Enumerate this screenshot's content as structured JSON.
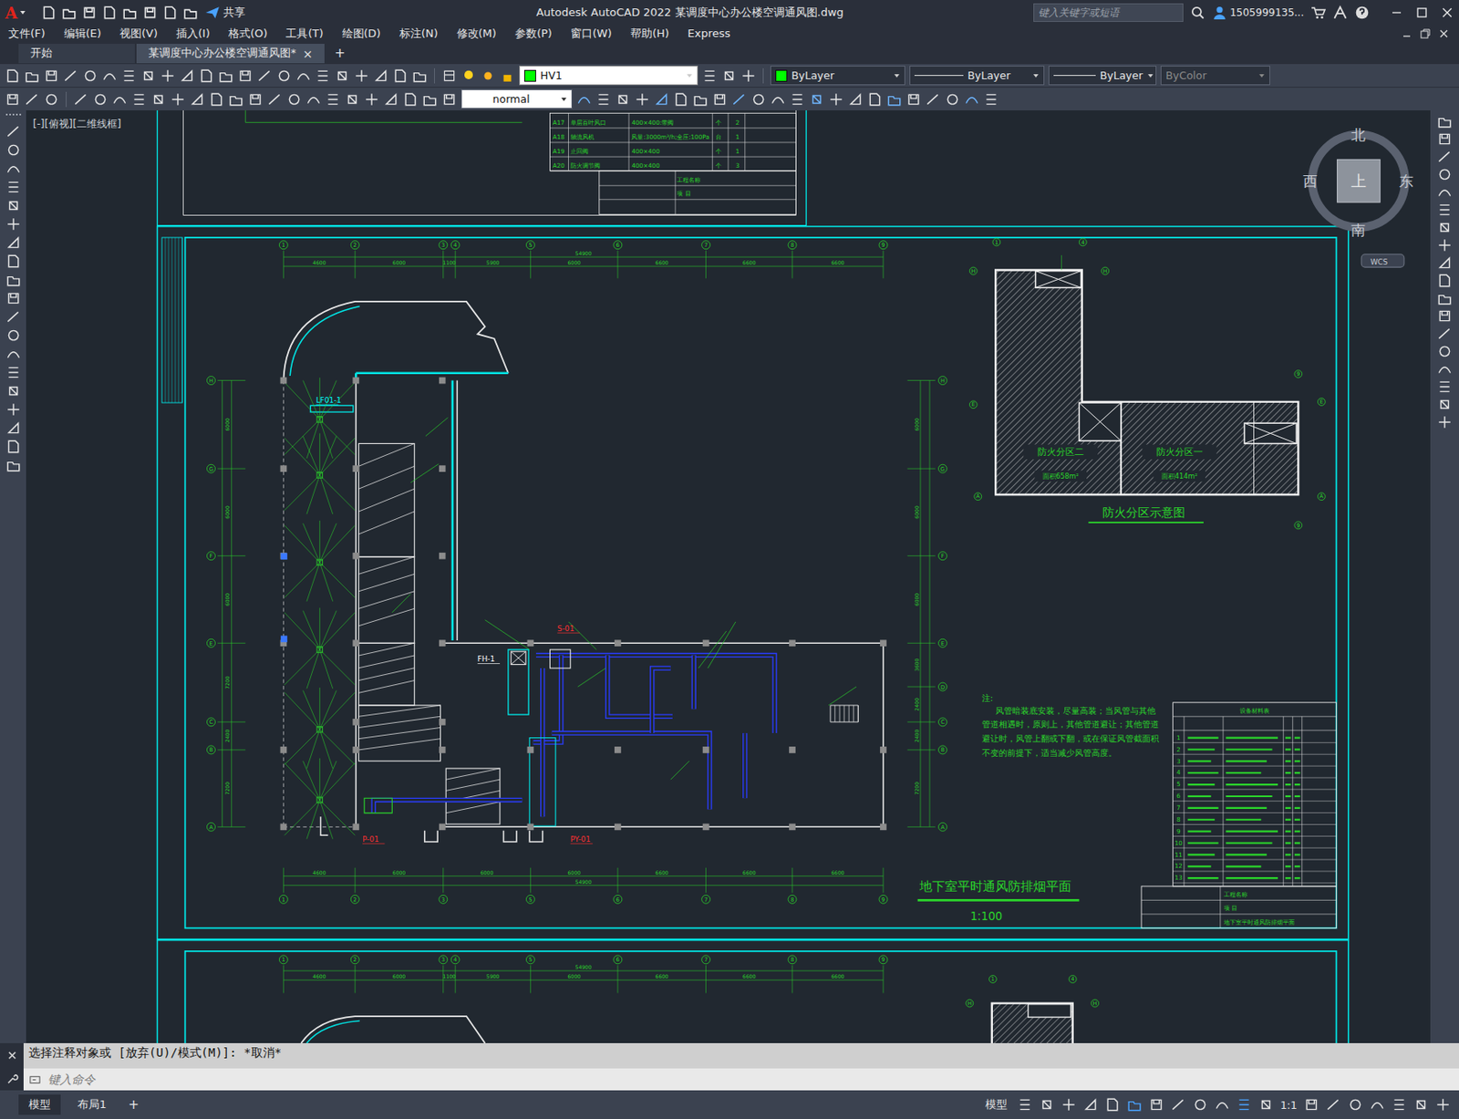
{
  "window": {
    "logo": "A",
    "share": "共享",
    "title": "Autodesk AutoCAD 2022    某调度中心办公楼空调通风图.dwg",
    "search": {
      "placeholder": "键入关键字或短语"
    },
    "user": "1505999135..."
  },
  "menu": [
    "文件(F)",
    "编辑(E)",
    "视图(V)",
    "插入(I)",
    "格式(O)",
    "工具(T)",
    "绘图(D)",
    "标注(N)",
    "修改(M)",
    "参数(P)",
    "窗口(W)",
    "帮助(H)",
    "Express"
  ],
  "tabs": [
    {
      "label": "开始",
      "selected": false
    },
    {
      "label": "某调度中心办公楼空调通风图*",
      "selected": true
    }
  ],
  "tab_close": "×",
  "tab_add": "+",
  "properties": {
    "layer": "HV1",
    "color": "ByLayer",
    "linetype": "ByLayer",
    "lineweight": "ByLayer",
    "plotstyle": {
      "value": "ByColor",
      "disabled": true
    },
    "textstyle": "normal"
  },
  "viewport_label": "[-][俯视][二维线框]",
  "viewcube": {
    "north": "北",
    "south": "南",
    "east": "东",
    "west": "西",
    "top": "上",
    "wcs": "WCS"
  },
  "drawing": {
    "top_axes": [
      "1",
      "2",
      "3",
      "4",
      "5",
      "6",
      "7",
      "8",
      "9"
    ],
    "bottom_axes": [
      "1",
      "2",
      "3",
      "5",
      "6",
      "7",
      "8",
      "9"
    ],
    "left_axes": [
      "H",
      "G",
      "F",
      "E",
      "C",
      "B",
      "A"
    ],
    "right_axes": [
      "H",
      "G",
      "F",
      "E",
      "D",
      "C",
      "B",
      "A"
    ],
    "top_total": "54900",
    "top_dims": [
      "4600",
      "6000",
      "1100",
      "5900",
      "6000",
      "6600",
      "6600",
      "6600"
    ],
    "bottom_total": "54900",
    "bottom_dims": [
      "4600",
      "6000",
      "6000",
      "6000",
      "6600",
      "6600",
      "6600"
    ],
    "left_dims": [
      "6000",
      "6000",
      "6000",
      "7200",
      "2400",
      "7200"
    ],
    "right_dims": [
      "6000",
      "6000",
      "6000",
      "3600",
      "2400",
      "2400",
      "7200"
    ],
    "labels": [
      {
        "text": "S-01",
        "color": "#ff3030"
      },
      {
        "text": "P-01",
        "color": "#ff3030"
      },
      {
        "text": "PY-01",
        "color": "#ff3030"
      },
      {
        "text": "LF01-1",
        "color": "#00ffff"
      },
      {
        "text": "FH-1",
        "color": "#ffffff"
      }
    ],
    "plan_title": "地下室平时通风防排烟平面",
    "plan_scale": "1:100",
    "fire_zone": {
      "title": "防火分区示意图",
      "zones": [
        {
          "name": "防火分区二",
          "area": "面积658m²"
        },
        {
          "name": "防火分区一",
          "area": "面积414m²"
        }
      ],
      "axes": [
        "1",
        "4",
        "H",
        "H",
        "E",
        "E",
        "A",
        "A",
        "9",
        "9"
      ]
    },
    "note": {
      "title": "注:",
      "lines": [
        "风管暗装底安装，尽量高装；当风管与其他",
        "管道相遇时，原则上，其他管道避让；其他管道",
        "避让时，风管上翻或下翻，或在保证风管截面积",
        "不变的前提下，适当减少风管高度。"
      ]
    },
    "upper_table": [
      {
        "no": "A17",
        "name": "单层百叶风口",
        "spec": "400×400:带阀",
        "unit": "个",
        "qty": "2"
      },
      {
        "no": "A18",
        "name": "轴流风机",
        "spec": "风量:3000m³/h;全压:100Pa",
        "unit": "台",
        "qty": "1"
      },
      {
        "no": "A19",
        "name": "止回阀",
        "spec": "400×400",
        "unit": "个",
        "qty": "1"
      },
      {
        "no": "A20",
        "name": "防火调节阀",
        "spec": "400×400",
        "unit": "个",
        "qty": "3"
      }
    ],
    "equipment_table": {
      "title": "设备材料表",
      "rows": [
        "1",
        "2",
        "3",
        "4",
        "5",
        "6",
        "7",
        "8",
        "9",
        "10",
        "11",
        "12",
        "13"
      ]
    },
    "title_block": {
      "project": "工程名称",
      "item": "项 目",
      "sheet": "地下室平时通风防排烟平面"
    }
  },
  "command": {
    "history": "选择注释对象或 [放弃(U)/模式(M)]: *取消*",
    "placeholder": "键入命令"
  },
  "status_bar": {
    "layouts": [
      {
        "label": "模型",
        "selected": true
      },
      {
        "label": "布局1",
        "selected": false
      }
    ],
    "add": "+",
    "mode": "模型",
    "scale": "1:1"
  }
}
